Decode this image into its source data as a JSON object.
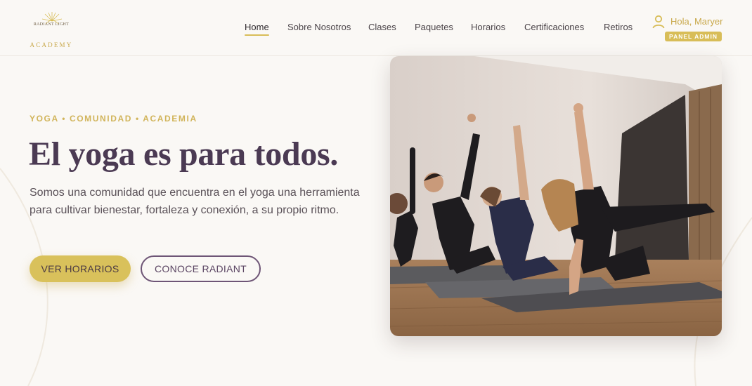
{
  "brand": {
    "logo_text": "RADIANT LIGHT",
    "logo_subtitle": "ACADEMY",
    "accent_color": "#d8bd58",
    "primary_color": "#4b3a53"
  },
  "nav": {
    "items": [
      {
        "label": "Home",
        "active": true
      },
      {
        "label": "Sobre Nosotros",
        "active": false
      },
      {
        "label": "Clases",
        "active": false
      },
      {
        "label": "Paquetes",
        "active": false
      },
      {
        "label": "Horarios",
        "active": false
      },
      {
        "label": "Certificaciones",
        "active": false
      },
      {
        "label": "Retiros",
        "active": false
      }
    ]
  },
  "user": {
    "icon": "user-icon",
    "greeting": "Hola, Maryer",
    "admin_badge": "PANEL ADMIN"
  },
  "hero": {
    "eyebrow": "YOGA • COMUNIDAD • ACADEMIA",
    "headline": "El yoga es para todos.",
    "lead": "Somos una comunidad que encuentra en el yoga una herramienta para cultivar bienestar, fortaleza y conexión, a su propio ritmo.",
    "primary_button": "VER HORARIOS",
    "secondary_button": "CONOCE RADIANT"
  }
}
